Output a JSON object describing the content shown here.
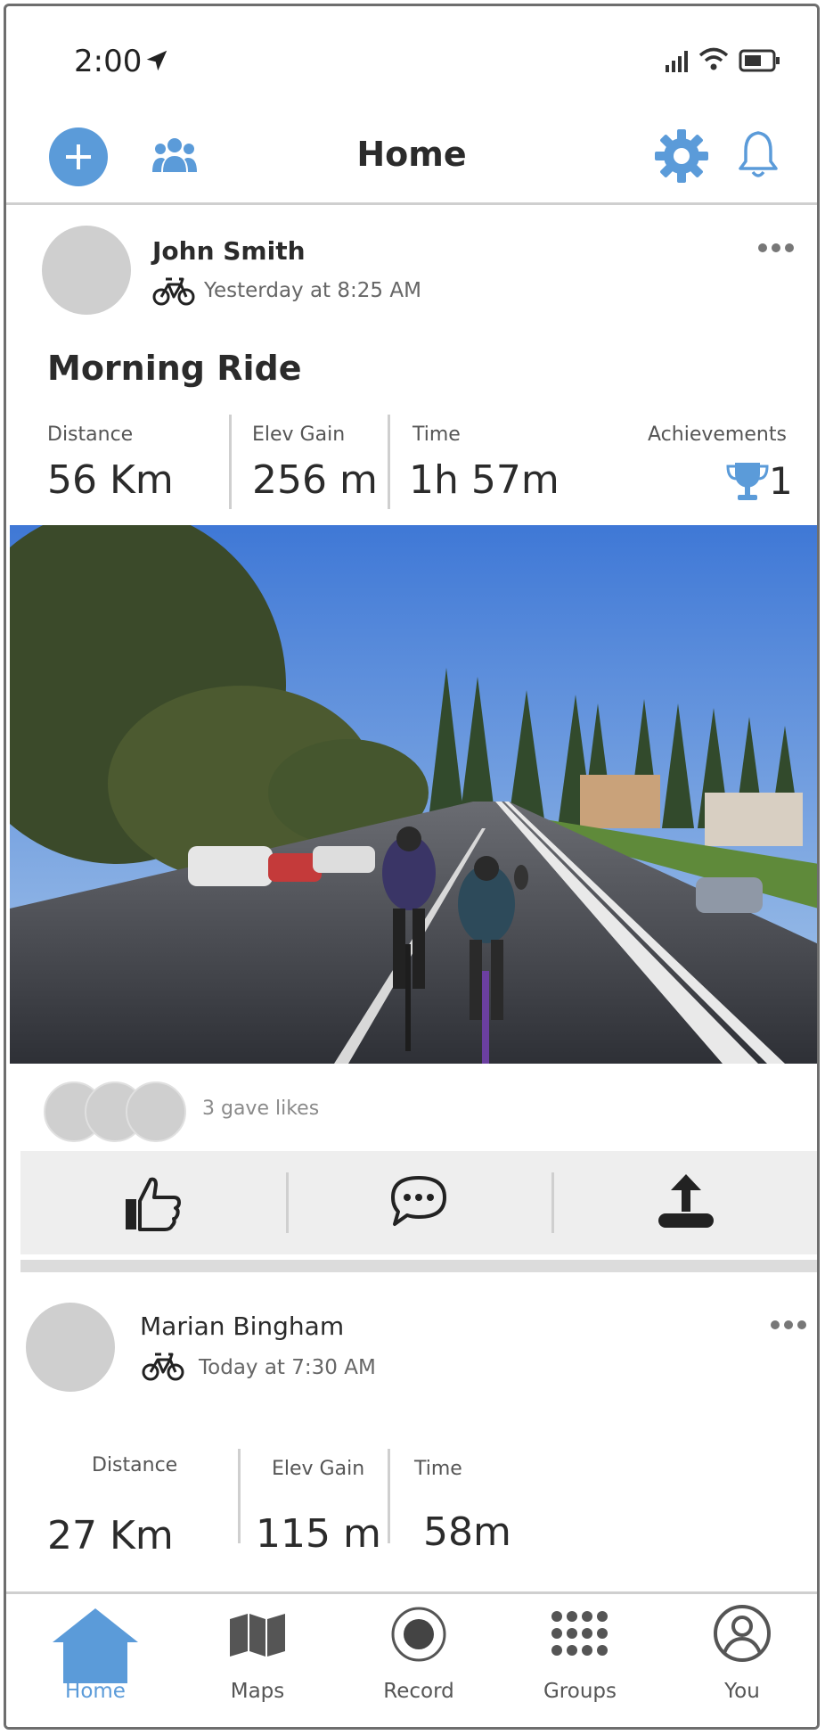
{
  "status_bar": {
    "time": "2:00"
  },
  "header": {
    "title": "Home"
  },
  "post1": {
    "author": "John Smith",
    "meta": "Yesterday at 8:25 AM",
    "title": "Morning Ride",
    "stats": [
      {
        "label": "Distance",
        "value": "56 Km"
      },
      {
        "label": "Elev Gain",
        "value": "256 m"
      },
      {
        "label": "Time",
        "value": "1h 57m"
      }
    ],
    "achievements": {
      "label": "Achievements",
      "value": "1"
    },
    "likes_text": "3 gave likes"
  },
  "post2": {
    "author": "Marian Bingham",
    "meta": "Today at 7:30 AM",
    "stats": [
      {
        "label": "Distance",
        "value": "27 Km"
      },
      {
        "label": "Elev Gain",
        "value": "115 m"
      },
      {
        "label": "Time",
        "value": "58m"
      }
    ]
  },
  "nav": {
    "items": [
      {
        "label": "Home",
        "icon": "home-icon",
        "active": true
      },
      {
        "label": "Maps",
        "icon": "map-icon",
        "active": false
      },
      {
        "label": "Record",
        "icon": "record-icon",
        "active": false
      },
      {
        "label": "Groups",
        "icon": "groups-icon",
        "active": false
      },
      {
        "label": "You",
        "icon": "profile-icon",
        "active": false
      }
    ]
  },
  "colors": {
    "accent": "#5b9bd9",
    "text": "#2b2b2b",
    "muted": "#8a8a8a",
    "placeholder": "#cfcfcf"
  }
}
